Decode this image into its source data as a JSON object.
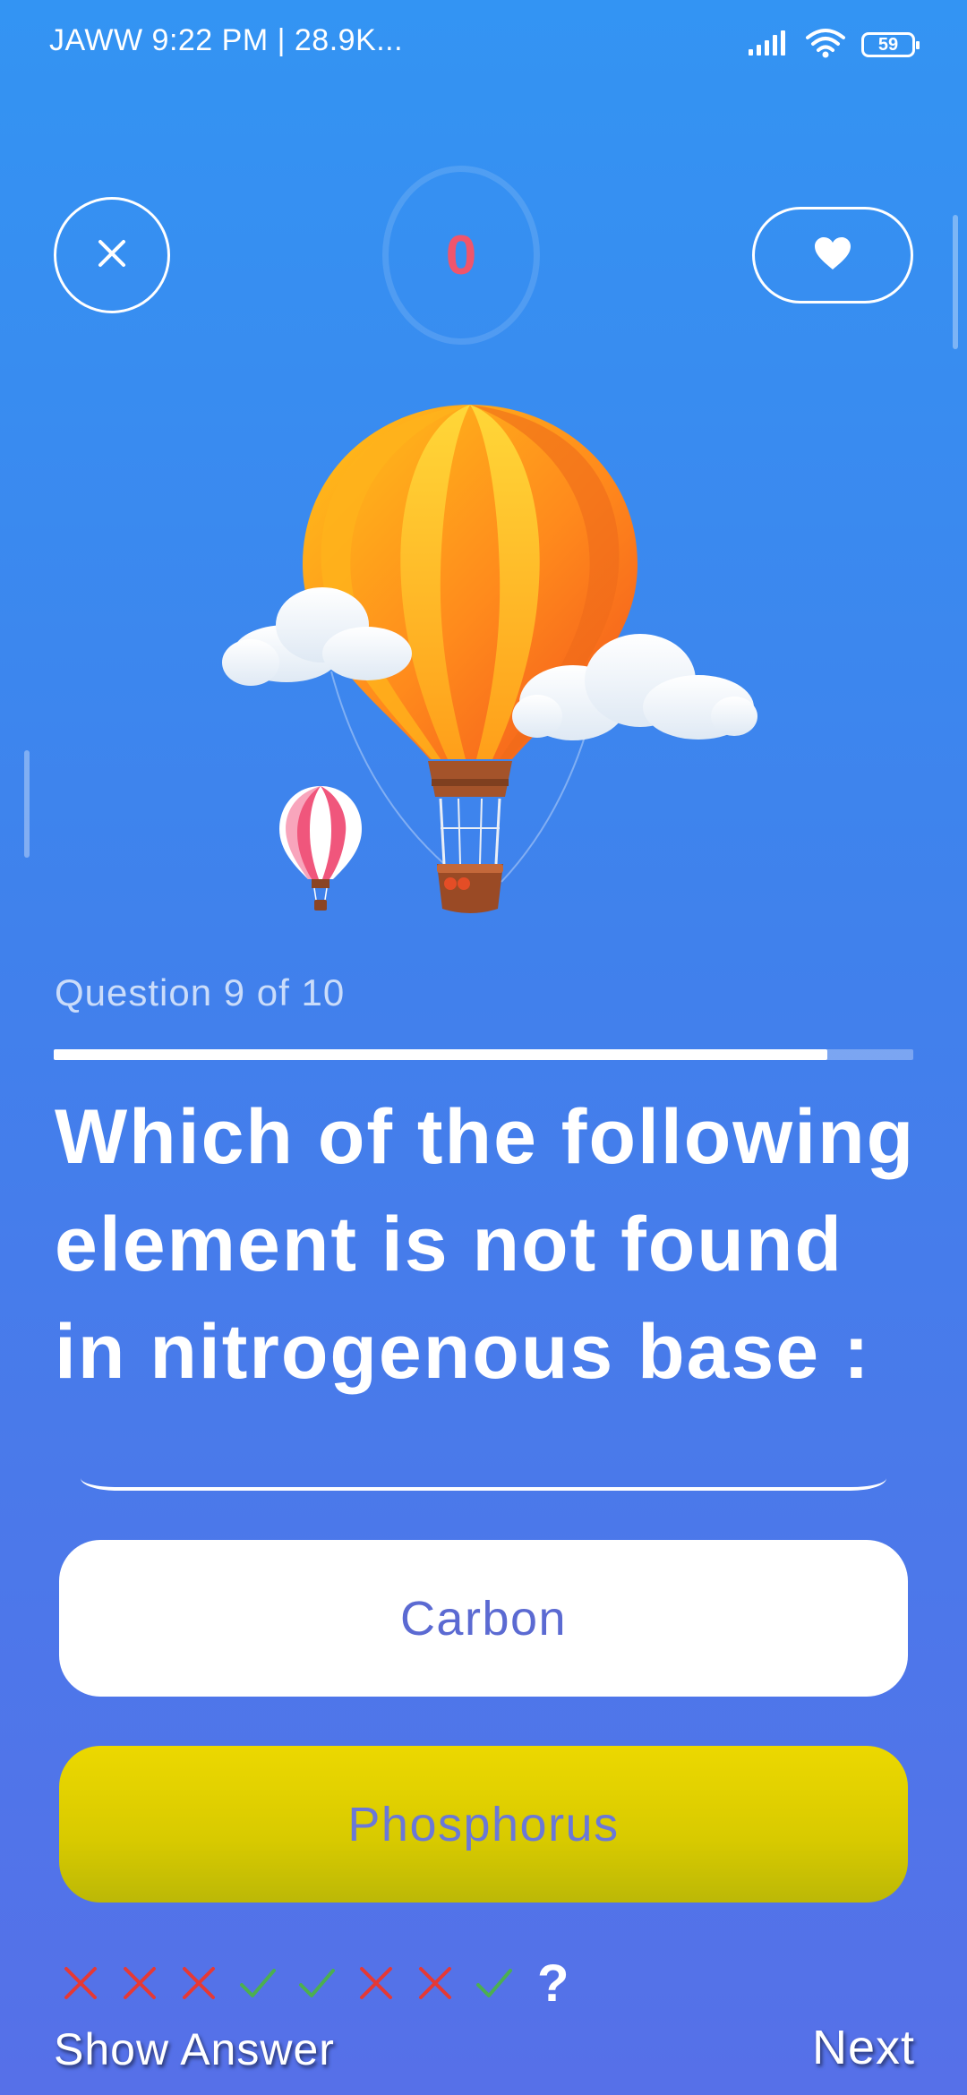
{
  "status_bar": {
    "text": "JAWW  9:22 PM | 28.9K...",
    "battery_level": "59",
    "icons": [
      "signal-icon",
      "wifi-icon",
      "battery-icon"
    ]
  },
  "header": {
    "close_icon": "close-icon",
    "timer_value": "0",
    "hearts_icon": "heart-icon"
  },
  "illustration": {
    "description_icon": "hot-air-balloon-illustration"
  },
  "quiz": {
    "counter": "Question 9 of 10",
    "progress": 0.9,
    "question": "Which of the following element is not found in nitrogenous base :",
    "options": [
      {
        "label": "Carbon",
        "state": "default"
      },
      {
        "label": "Phosphorus",
        "state": "selected"
      }
    ]
  },
  "answer_history": {
    "marks": [
      "wrong",
      "wrong",
      "wrong",
      "correct",
      "correct",
      "wrong",
      "wrong",
      "correct"
    ],
    "current": "?"
  },
  "actions": {
    "show_answer": "Show Answer",
    "next": "Next"
  },
  "colors": {
    "wrong": "#e53935",
    "correct": "#4caf50",
    "timer": "#f0556b",
    "selected_option": "#e3d200"
  }
}
